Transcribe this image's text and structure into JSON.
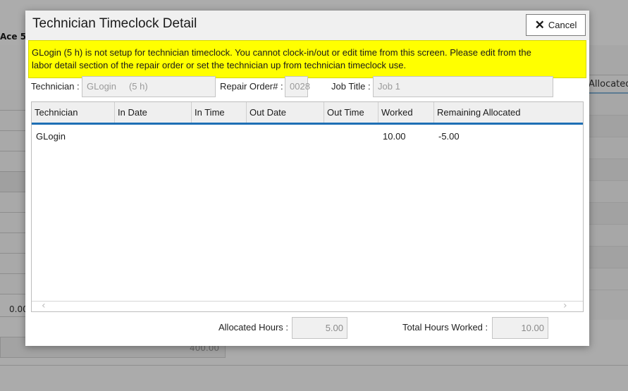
{
  "background": {
    "vehicle_label": "Ace 5",
    "left_value": "0.00",
    "allocated_header": "Allocated",
    "total_value": "400.00"
  },
  "modal": {
    "title": "Technician Timeclock Detail",
    "cancel_label": "Cancel",
    "warning_line1": "GLogin (5 h) is not setup for technician timeclock. You cannot clock-in/out or edit time from this screen. Please edit from the",
    "warning_line2": "labor detail section of the repair order or set the technician up from technician timeclock use.",
    "fields": {
      "technician_label": "Technician :",
      "technician_value": "GLogin     (5 h)",
      "repair_order_label": "Repair Order# :",
      "repair_order_value": "0028",
      "job_title_label": "Job Title :",
      "job_title_value": "Job 1"
    },
    "grid": {
      "columns": [
        "Technician",
        "In Date",
        "In Time",
        "Out Date",
        "Out Time",
        "Worked",
        "Remaining Allocated"
      ],
      "rows": [
        {
          "technician": "GLogin",
          "in_date": "",
          "in_time": "",
          "out_date": "",
          "out_time": "",
          "worked": "10.00",
          "remaining_allocated": "-5.00"
        }
      ]
    },
    "footer": {
      "allocated_hours_label": "Allocated Hours :",
      "allocated_hours_value": "5.00",
      "total_hours_label": "Total Hours Worked :",
      "total_hours_value": "10.00"
    }
  },
  "icons": {
    "cancel": "close-icon",
    "scroll_left": "chevron-left-icon",
    "scroll_right": "chevron-right-icon"
  },
  "colors": {
    "warning_bg": "#ffff00",
    "grid_header_accent": "#1e6fb5"
  }
}
